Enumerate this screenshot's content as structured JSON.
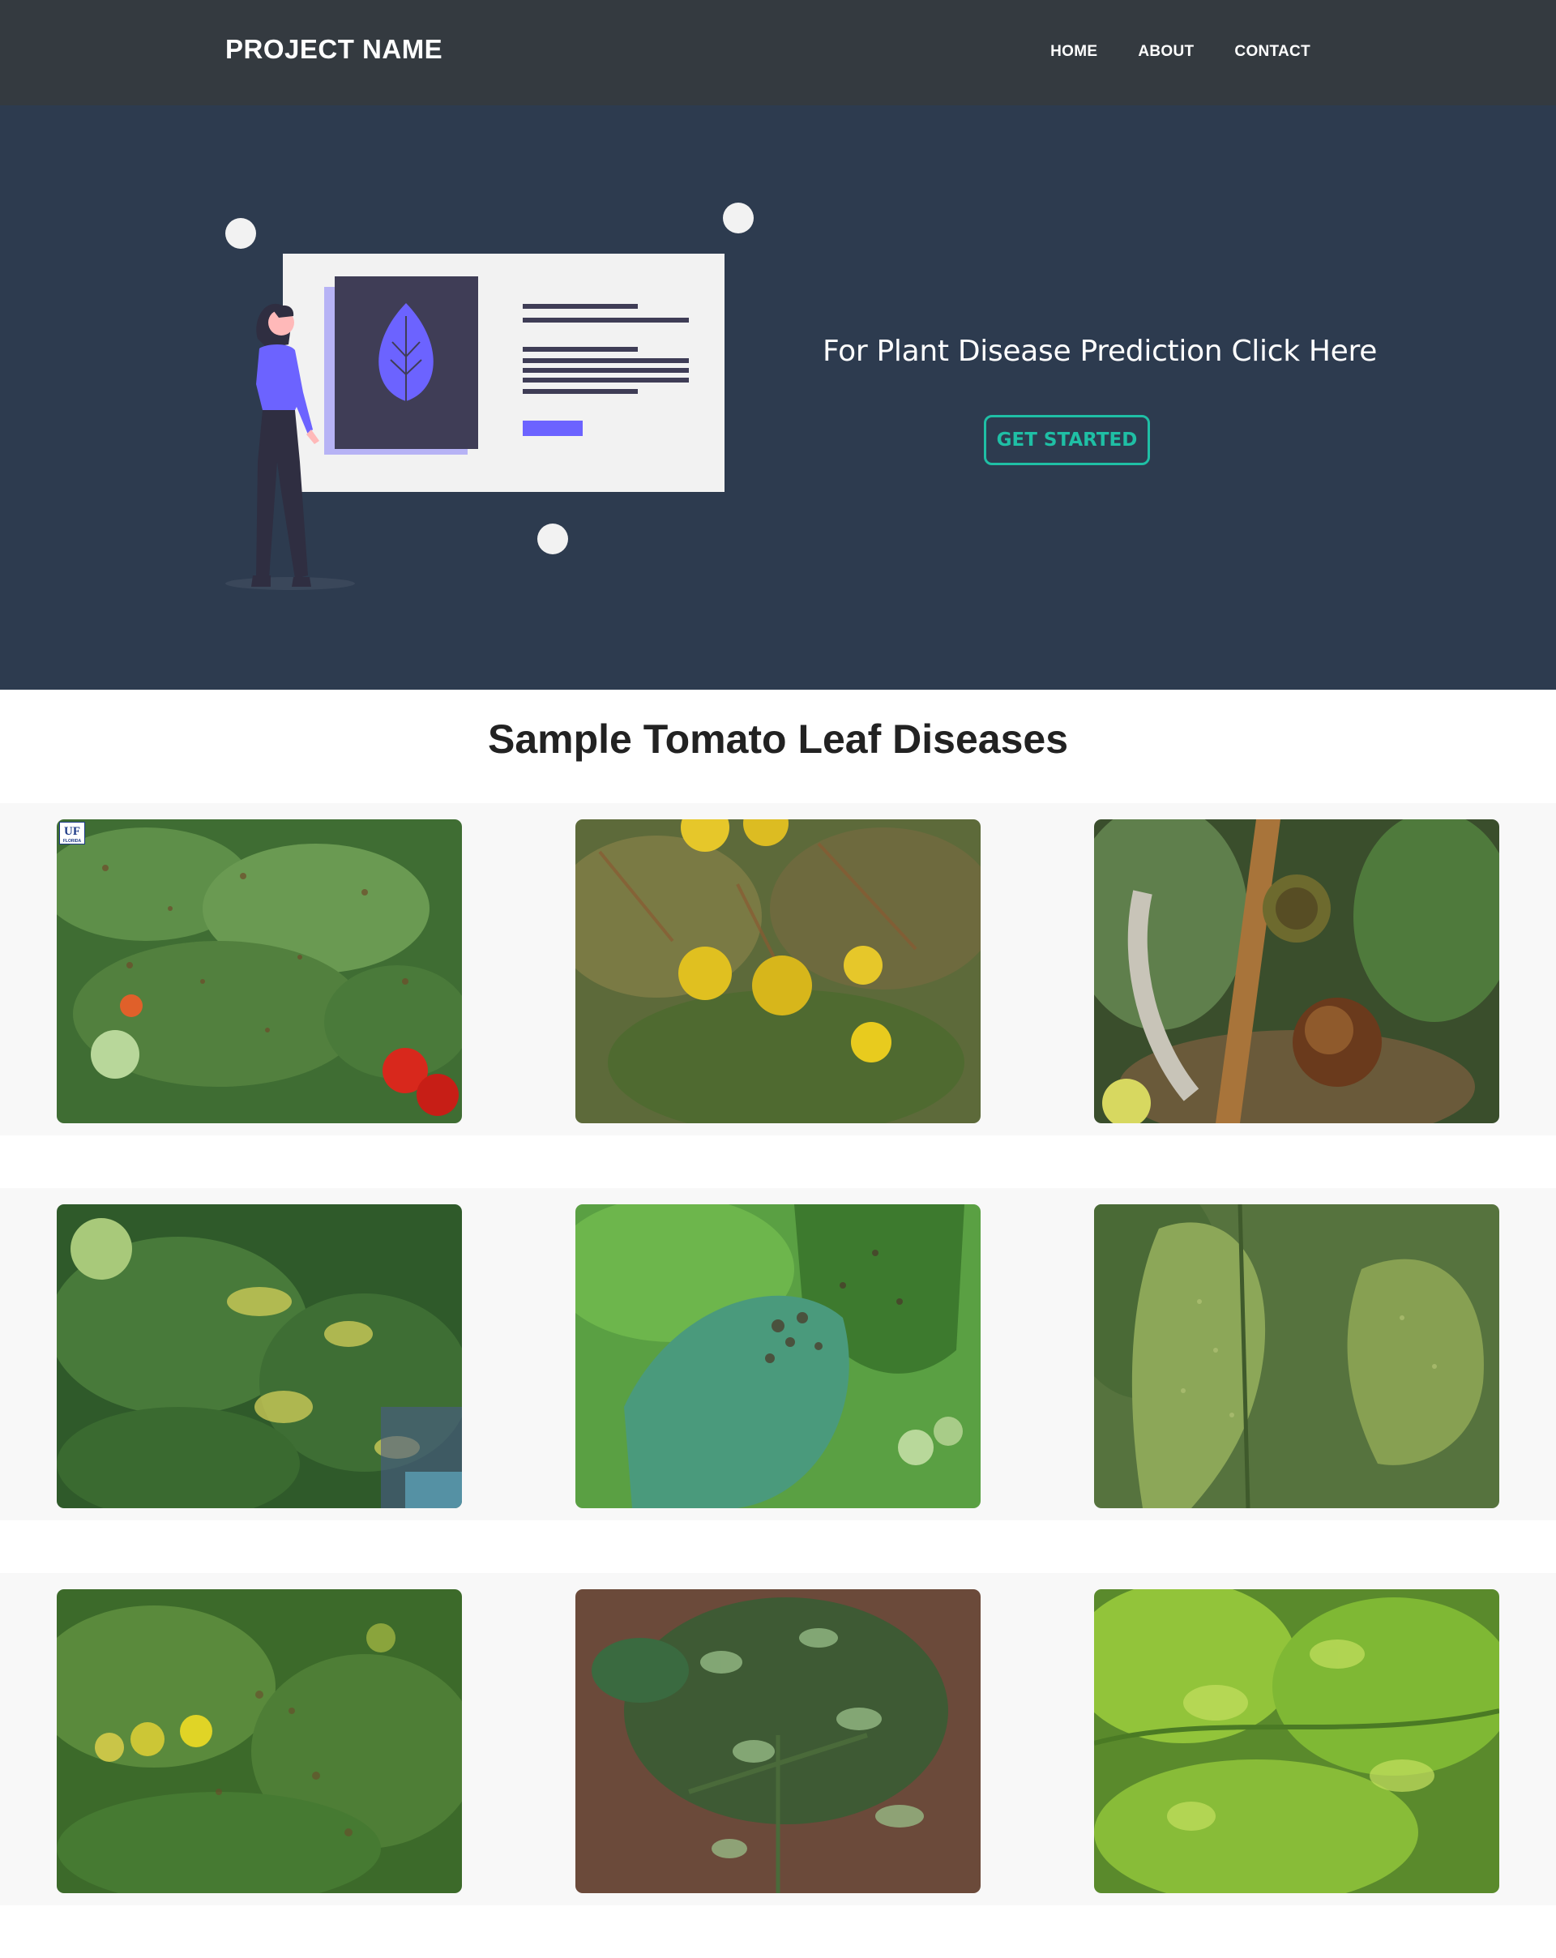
{
  "navbar": {
    "brand": "PROJECT NAME",
    "links": [
      {
        "label": "HOME"
      },
      {
        "label": "ABOUT"
      },
      {
        "label": "CONTACT"
      }
    ]
  },
  "hero": {
    "tagline": "For Plant Disease Prediction Click Here",
    "button_label": "GET STARTED",
    "colors": {
      "background": "#2d3b4f",
      "button_accent": "#1fbfa5",
      "illustration_accent": "#6c63ff"
    }
  },
  "gallery": {
    "title": "Sample Tomato Leaf Diseases",
    "logo_text": "UF",
    "logo_subtext": "FLORIDA",
    "rows": [
      {
        "images": [
          {
            "name": "leaf-spots-with-red-tomatoes"
          },
          {
            "name": "yellowing-tomatoes-wilted-leaves"
          },
          {
            "name": "rotting-tomato-fruit"
          }
        ]
      },
      {
        "images": [
          {
            "name": "yellow-mottled-leaves"
          },
          {
            "name": "dark-lesions-on-leaf"
          },
          {
            "name": "speckled-leaf-mite-damage"
          }
        ]
      },
      {
        "images": [
          {
            "name": "yellow-cherry-tomatoes-spots"
          },
          {
            "name": "mosaic-curled-leaves"
          },
          {
            "name": "light-green-mosaic-leaves"
          }
        ]
      }
    ]
  }
}
